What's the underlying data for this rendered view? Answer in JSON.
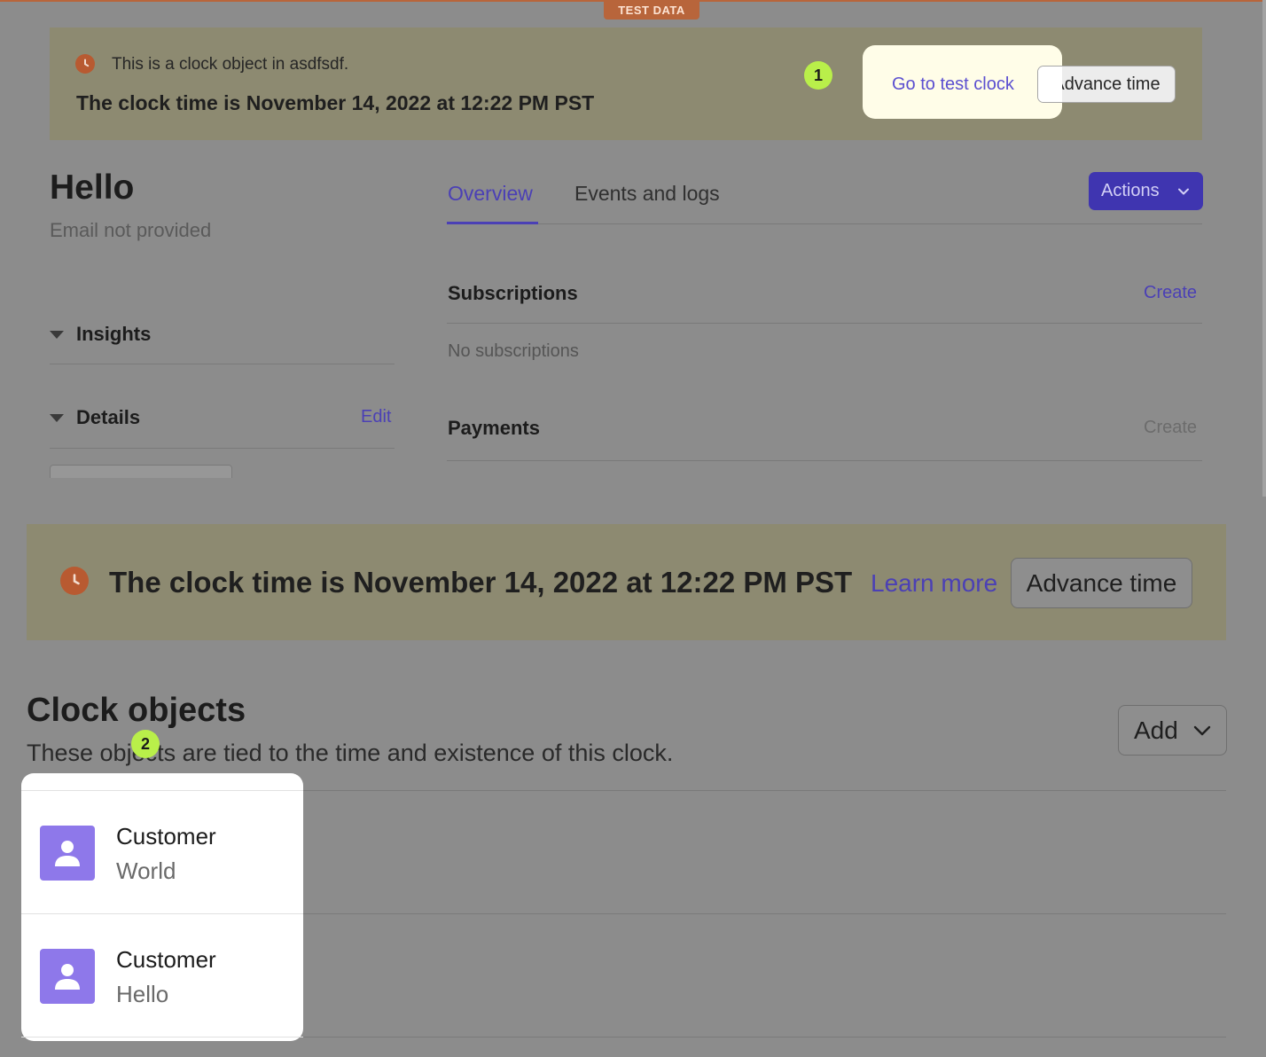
{
  "test_badge": "TEST DATA",
  "banner_top": {
    "message": "This is a clock object in asdfsdf.",
    "clock_time": "The clock time is November 14, 2022 at 12:22 PM PST",
    "go_to_link": "Go to test clock",
    "advance_button": "Advance time",
    "icon": "clock-icon"
  },
  "customer": {
    "name": "Hello",
    "email": "Email not provided"
  },
  "tabs": [
    {
      "label": "Overview",
      "active": true
    },
    {
      "label": "Events and logs",
      "active": false
    }
  ],
  "actions_button": "Actions",
  "sections": {
    "subscriptions": {
      "title": "Subscriptions",
      "create": "Create",
      "empty": "No subscriptions"
    },
    "payments": {
      "title": "Payments",
      "create": "Create"
    },
    "insights": {
      "title": "Insights"
    },
    "details": {
      "title": "Details",
      "edit": "Edit"
    }
  },
  "banner_clock": {
    "clock_time": "The clock time is November 14, 2022 at 12:22 PM PST",
    "learn_more": "Learn more",
    "advance_button": "Advance time",
    "icon": "clock-icon"
  },
  "clock_objects": {
    "title": "Clock objects",
    "description": "These objects are tied to the time and existence of this clock.",
    "add_button": "Add",
    "items": [
      {
        "type": "Customer",
        "name": "World",
        "icon": "customer-icon"
      },
      {
        "type": "Customer",
        "name": "Hello",
        "icon": "customer-icon"
      }
    ]
  },
  "callouts": [
    "1",
    "2"
  ],
  "colors": {
    "accent": "#4b40b5",
    "actions_button": "#3f35b0",
    "banner": "#8d8a71",
    "clock_icon": "#b85a31",
    "avatar": "#8e78ea",
    "step_marker": "#b9ef4a",
    "test_badge": "#b8653b"
  }
}
